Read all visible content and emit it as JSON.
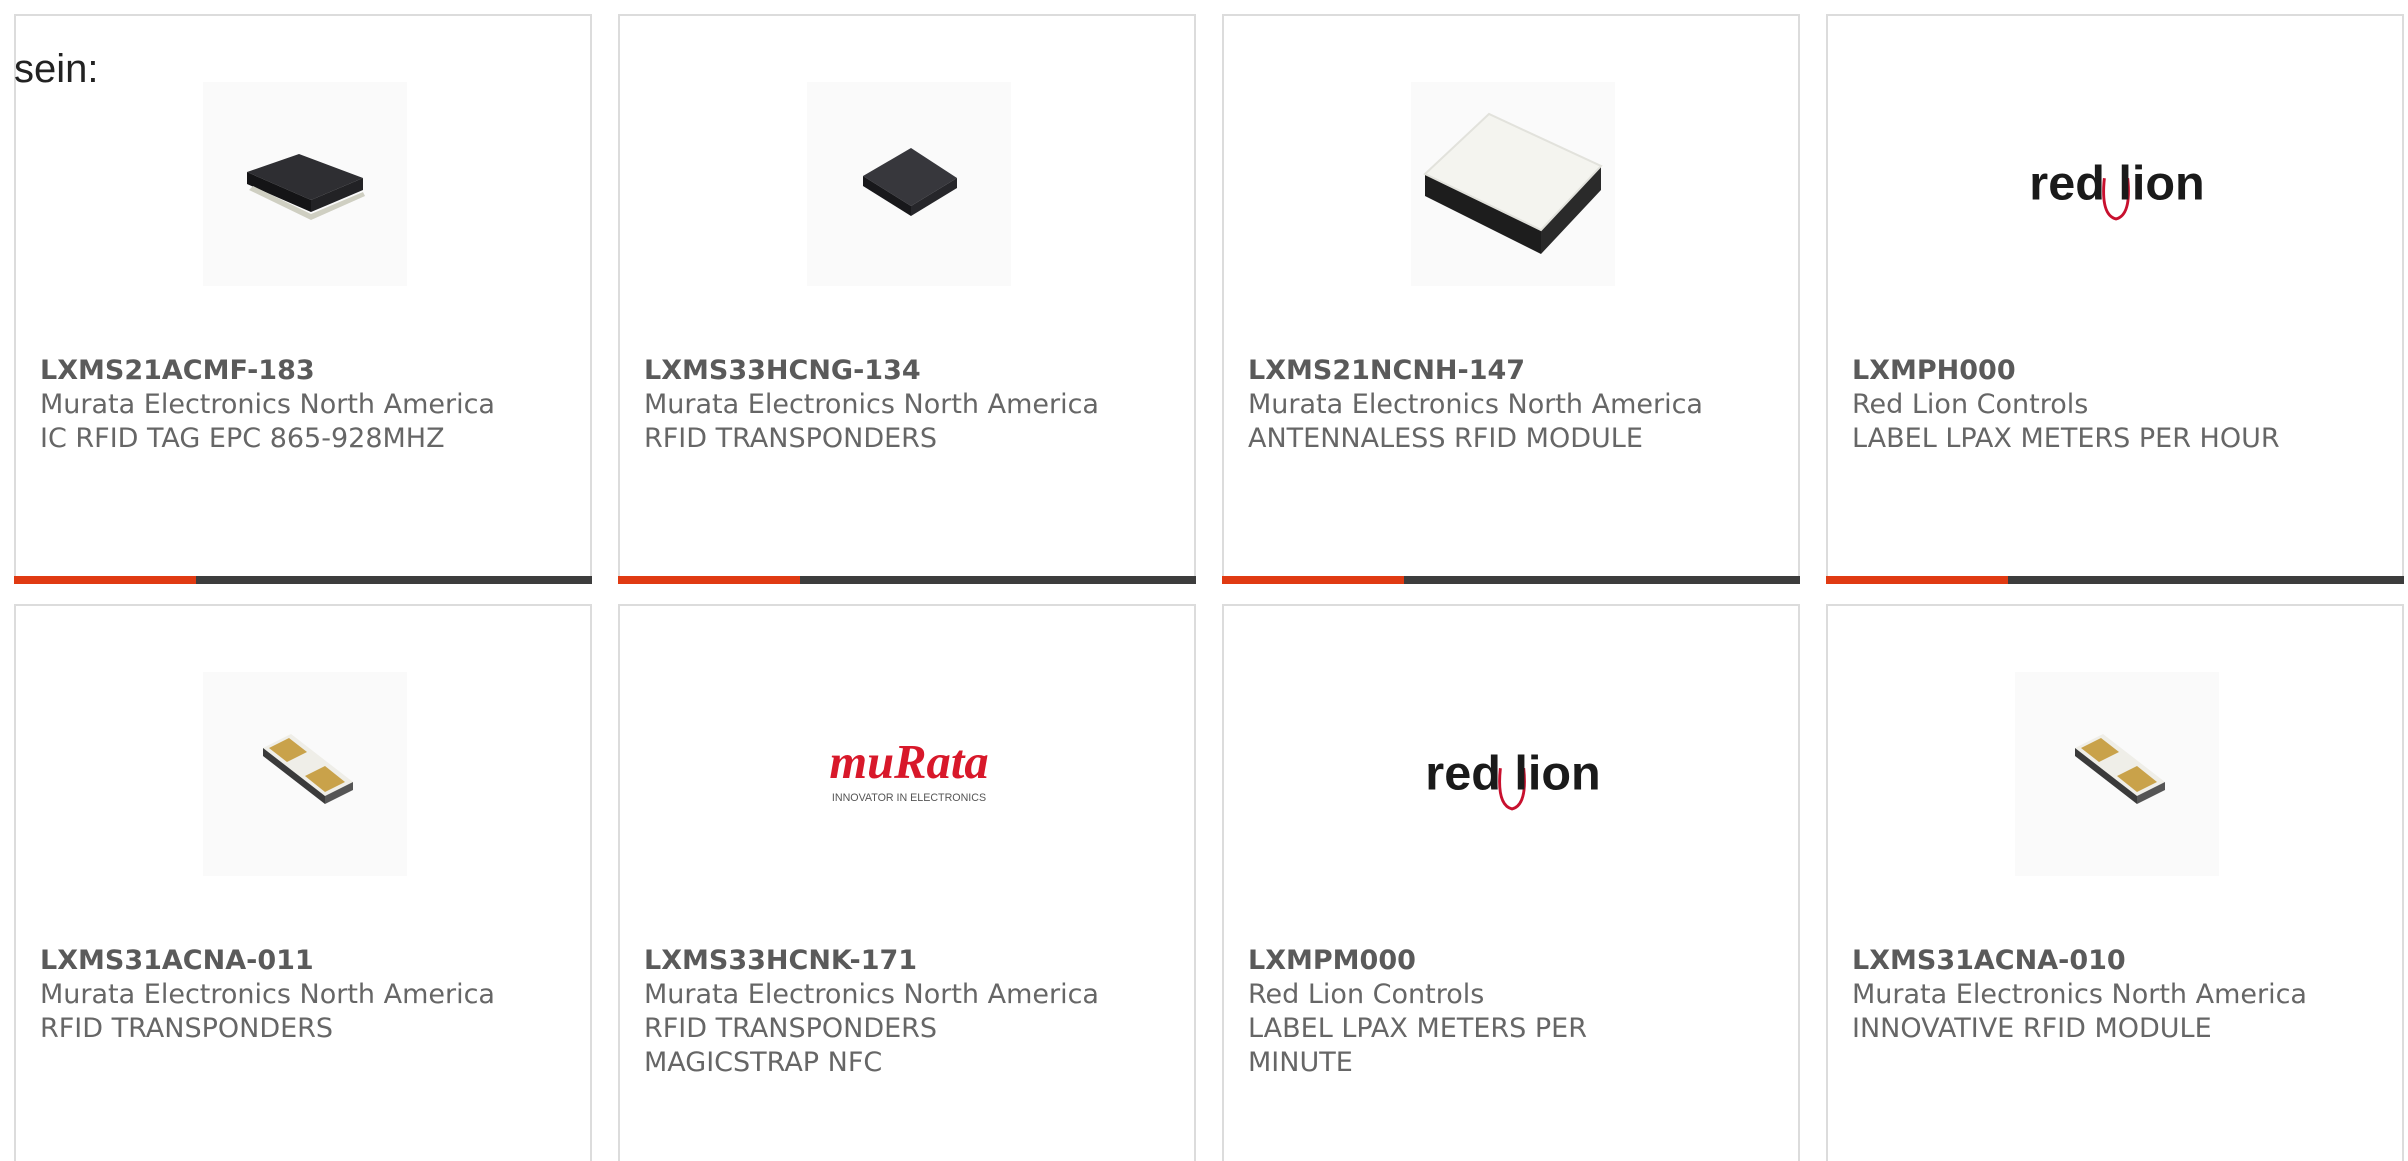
{
  "intro_text": "sein:",
  "colors": {
    "accent": "#e03a12",
    "bar_dark": "#3d3d3d",
    "card_border": "#dcdcdc",
    "text": "#666666",
    "redlion_red": "#c8102e",
    "murata_red": "#d8182a"
  },
  "products": [
    {
      "part_number": "LXMS21ACMF-183",
      "manufacturer": "Murata Electronics North America",
      "description_lines": [
        "IC RFID TAG EPC 865-928MHZ"
      ],
      "image": "black-chip",
      "has_progress_bar": true
    },
    {
      "part_number": "LXMS33HCNG-134",
      "manufacturer": "Murata Electronics North America",
      "description_lines": [
        "RFID TRANSPONDERS"
      ],
      "image": "black-chip-square",
      "has_progress_bar": true
    },
    {
      "part_number": "LXMS21NCNH-147",
      "manufacturer": "Murata Electronics North America",
      "description_lines": [
        "ANTENNALESS RFID MODULE"
      ],
      "image": "white-module",
      "has_progress_bar": true
    },
    {
      "part_number": "LXMPH000",
      "manufacturer": "Red Lion Controls",
      "description_lines": [
        "LABEL LPAX METERS PER HOUR"
      ],
      "image": "red-lion-logo",
      "logo_text": "red lion",
      "has_progress_bar": true
    },
    {
      "part_number": "LXMS31ACNA-011",
      "manufacturer": "Murata Electronics North America",
      "description_lines": [
        "RFID TRANSPONDERS"
      ],
      "image": "gold-pad-chip",
      "has_progress_bar": false
    },
    {
      "part_number": "LXMS33HCNK-171",
      "manufacturer": "Murata Electronics North America",
      "description_lines": [
        "RFID TRANSPONDERS",
        "MAGICSTRAP NFC"
      ],
      "image": "murata-logo",
      "logo_text": "muRata",
      "logo_subtext": "INNOVATOR IN ELECTRONICS",
      "has_progress_bar": false
    },
    {
      "part_number": "LXMPM000",
      "manufacturer": "Red Lion Controls",
      "description_lines": [
        "LABEL LPAX METERS PER",
        "MINUTE"
      ],
      "image": "red-lion-logo",
      "logo_text": "red lion",
      "has_progress_bar": false
    },
    {
      "part_number": "LXMS31ACNA-010",
      "manufacturer": "Murata Electronics North America",
      "description_lines": [
        "INNOVATIVE RFID MODULE"
      ],
      "image": "gold-pad-chip",
      "has_progress_bar": false
    }
  ]
}
